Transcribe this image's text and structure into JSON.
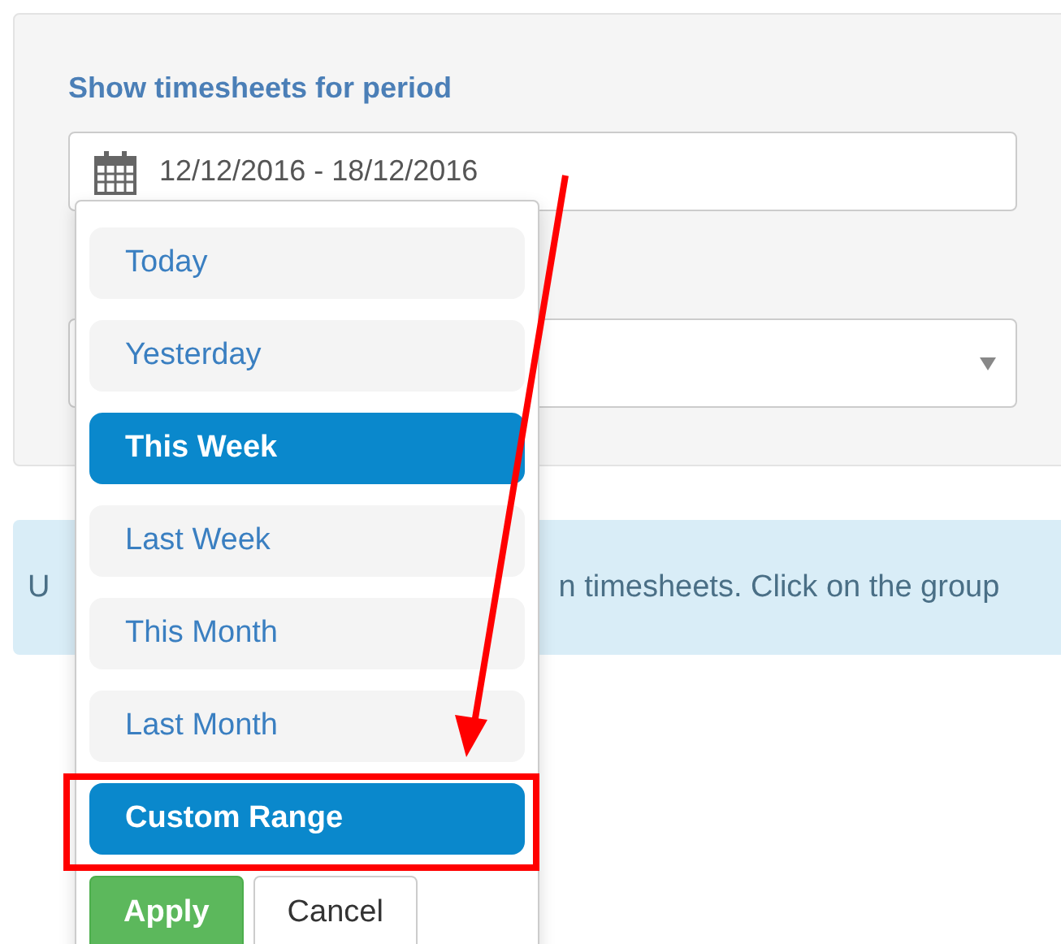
{
  "filter_panel": {
    "period_label": "Show timesheets for period",
    "date_range": {
      "value": "12/12/2016 - 18/12/2016"
    },
    "select": {
      "kind": "dropdown"
    }
  },
  "info_bar": {
    "text_left": "U",
    "text_right": "n timesheets. Click on the group"
  },
  "range_menu": {
    "items": [
      {
        "label": "Today",
        "selected": false
      },
      {
        "label": "Yesterday",
        "selected": false
      },
      {
        "label": "This Week",
        "selected": true
      },
      {
        "label": "Last Week",
        "selected": false
      },
      {
        "label": "This Month",
        "selected": false
      },
      {
        "label": "Last Month",
        "selected": false
      },
      {
        "label": "Custom Range",
        "selected": true,
        "highlighted": true
      }
    ],
    "buttons": [
      {
        "label": "Apply",
        "kind": "primary"
      },
      {
        "label": "Cancel",
        "kind": "default"
      }
    ]
  }
}
